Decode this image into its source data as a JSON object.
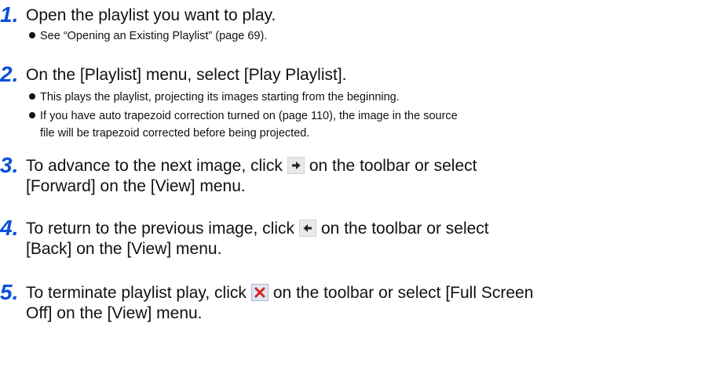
{
  "steps": [
    {
      "number": "1.",
      "text": "Open the playlist you want to play.",
      "bullets": [
        "See “Opening an Existing Playlist” (page 69)."
      ]
    },
    {
      "number": "2.",
      "text": "On the [Playlist] menu, select [Play Playlist].",
      "bullets": [
        "This plays the playlist, projecting its images starting from the beginning.",
        "If you have auto trapezoid correction turned on (page 110), the image in the source"
      ],
      "bullet_continuation": "file will be trapezoid corrected before being projected."
    },
    {
      "number": "3.",
      "text_before_icon": "To advance to the next image, click",
      "icon": "forward-arrow-icon",
      "text_after_icon": "on the toolbar or select",
      "text_line2": "[Forward] on the [View] menu."
    },
    {
      "number": "4.",
      "text_before_icon": "To return to the previous image, click",
      "icon": "back-arrow-icon",
      "text_after_icon": "on the toolbar or select",
      "text_line2": "[Back] on the [View] menu."
    },
    {
      "number": "5.",
      "text_before_icon": "To terminate playlist play, click",
      "icon": "close-x-icon",
      "text_after_icon": "on the toolbar or select [Full Screen",
      "text_line2": "Off] on the [View] menu."
    }
  ],
  "colors": {
    "step_number": "#0a4fd6",
    "text": "#111111"
  }
}
